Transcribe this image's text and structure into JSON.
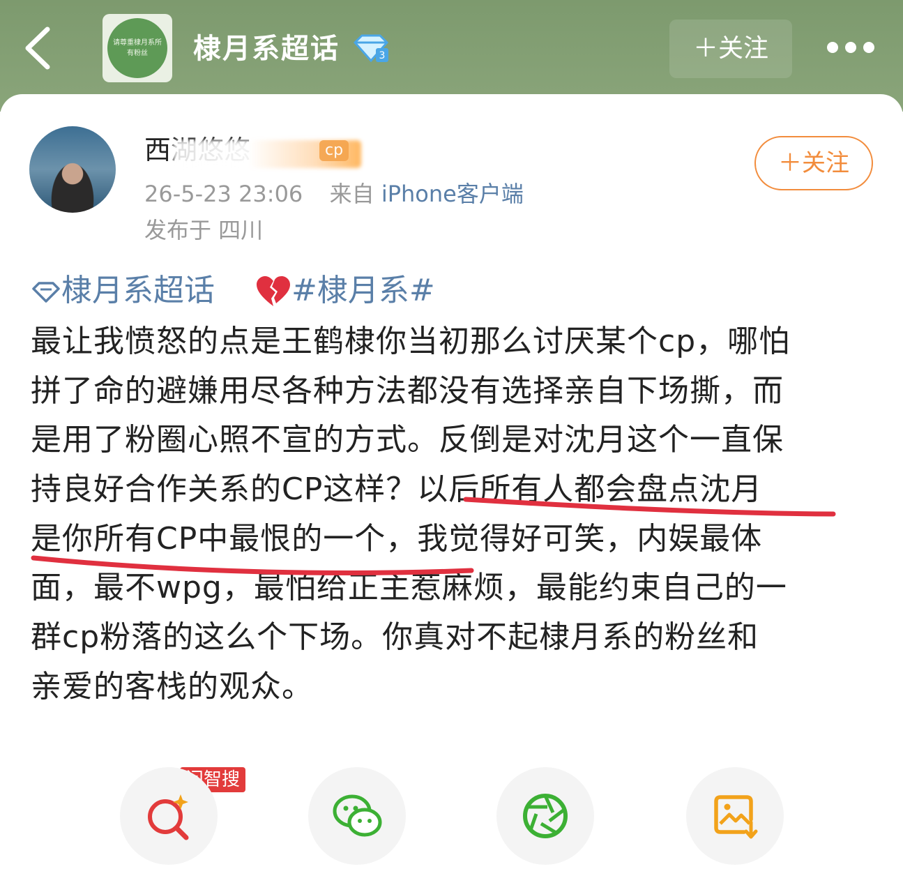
{
  "header": {
    "back_icon": "chevron-left-icon",
    "logo_text": "请尊重棣月系所有粉丝",
    "title": "棣月系超话",
    "badge_icon": "diamond-level-icon",
    "follow_label": "＋关注",
    "more_icon": "more-dots-icon"
  },
  "post": {
    "author": {
      "name_visible": "西湖悠悠",
      "name_tag": "cp",
      "follow_label": "＋关注"
    },
    "timestamp": "26-5-23 23:06",
    "source_prefix": "来自",
    "source_device": "iPhone客户端",
    "location": "发布于 四川",
    "topics": [
      {
        "label": "棣月系超话",
        "icon": "diamond-icon"
      },
      {
        "label": "#棣月系#",
        "icon": "broken-heart-emoji"
      }
    ],
    "body_lines": [
      "最让我愤怒的点是王鹤棣你当初那么讨厌某个cp，哪怕",
      "拼了命的避嫌用尽各种方法都没有选择亲自下场撕，而",
      "是用了粉圈心照不宣的方式。反倒是对沈月这个一直保",
      "持良好合作关系的CP这样？以后所有人都会盘点沈月",
      "是你所有CP中最恨的一个，我觉得好可笑，内娱最体",
      "面，最不wpg，最怕给正主惹麻烦，最能约束自己的一",
      "群cp粉落的这么个下场。你真对不起棣月系的粉丝和",
      "亲爱的客栈的观众。"
    ],
    "annotation_color": "#e0303f"
  },
  "actions": {
    "ai_badge": "问智搜",
    "items": [
      {
        "icon": "ai-search-icon",
        "color": "#e23b3b"
      },
      {
        "icon": "wechat-icon",
        "color": "#3cb034"
      },
      {
        "icon": "moments-icon",
        "color": "#3cb034"
      },
      {
        "icon": "save-image-icon",
        "color": "#f2a21a"
      }
    ]
  },
  "colors": {
    "header_bg": "#84a075",
    "link": "#5a7fa8",
    "follow": "#f28c3c"
  }
}
